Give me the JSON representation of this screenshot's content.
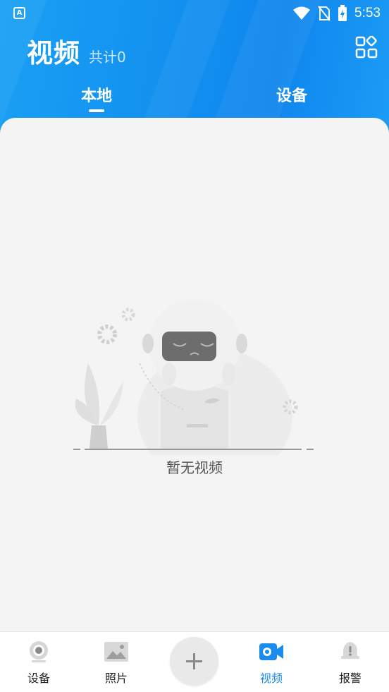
{
  "status_bar": {
    "time": "5:53",
    "app_icon": "A",
    "icons": [
      "wifi-icon",
      "no-sim-icon",
      "battery-charging-icon"
    ]
  },
  "header": {
    "title": "视频",
    "count": "共计0",
    "grid_icon": "grid-apps-icon"
  },
  "tabs": [
    {
      "label": "本地",
      "active": true
    },
    {
      "label": "设备",
      "active": false
    }
  ],
  "empty_state": {
    "message": "暂无视频",
    "illustration": "sad-robot-illustration"
  },
  "bottom_nav": {
    "items": [
      {
        "label": "设备",
        "icon": "camera-device-icon",
        "active": false
      },
      {
        "label": "照片",
        "icon": "photo-icon",
        "active": false
      },
      {
        "label": "视频",
        "icon": "video-camera-icon",
        "active": true
      },
      {
        "label": "报警",
        "icon": "alarm-bell-icon",
        "active": false
      }
    ],
    "add_icon": "plus-icon"
  },
  "colors": {
    "header_blue": "#1290f0",
    "active_nav": "#1a8cf0",
    "background": "#f4f4f4"
  }
}
